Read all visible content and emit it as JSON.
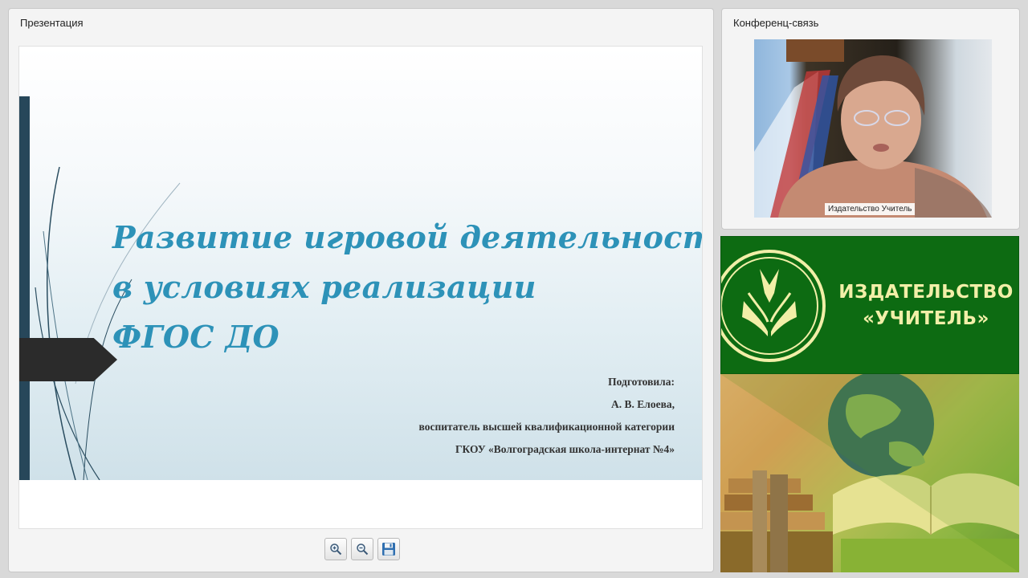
{
  "presentation_panel": {
    "title": "Презентация",
    "slide": {
      "title_lines": [
        "Развитие игровой деятельности",
        "в условиях реализации",
        "ФГОС ДО"
      ],
      "credits": [
        "Подготовила:",
        "А. В. Елоева,",
        "воспитатель высшей квалификационной категории",
        "ГКОУ «Волгоградская школа-интернат №4»"
      ]
    },
    "toolbar": {
      "zoom_in_icon": "zoom-in-icon",
      "zoom_out_icon": "zoom-out-icon",
      "save_icon": "save-icon"
    }
  },
  "conference_panel": {
    "title": "Конференц-связь",
    "participant_label": "Издательство Учитель"
  },
  "branding": {
    "lines": [
      "ИЗДАТЕЛЬСТВО",
      "«УЧИТЕЛЬ»"
    ],
    "colors": {
      "green": "#0d6b12",
      "text": "#f2efa8"
    }
  }
}
